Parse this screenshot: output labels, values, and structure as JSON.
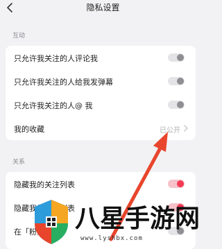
{
  "header": {
    "title": "隐私设置",
    "back_icon": "chevron-left-icon"
  },
  "sections": [
    {
      "label": "互动",
      "rows": [
        {
          "label": "只允许我关注的人评论我",
          "control": "toggle",
          "on": false
        },
        {
          "label": "只允许我关注的人给我发弹幕",
          "control": "toggle",
          "on": false
        },
        {
          "label": "只允许我关注的人@ 我",
          "control": "toggle",
          "on": false
        },
        {
          "label": "我的收藏",
          "control": "link",
          "value": "已公开"
        }
      ]
    },
    {
      "label": "关系",
      "rows": [
        {
          "label": "隐藏我的关注列表",
          "control": "toggle",
          "on": true
        },
        {
          "label": "隐藏我的粉丝列表",
          "control": "toggle",
          "on": true
        },
        {
          "label": "在「粉丝」",
          "control": "toggle",
          "on": false
        }
      ]
    }
  ],
  "colors": {
    "accent": "#f23a55",
    "arrow": "#e8452c",
    "background": "#f2f2f4"
  },
  "watermark": {
    "text": "八星手游网",
    "url": "www.lyshbx.com"
  }
}
